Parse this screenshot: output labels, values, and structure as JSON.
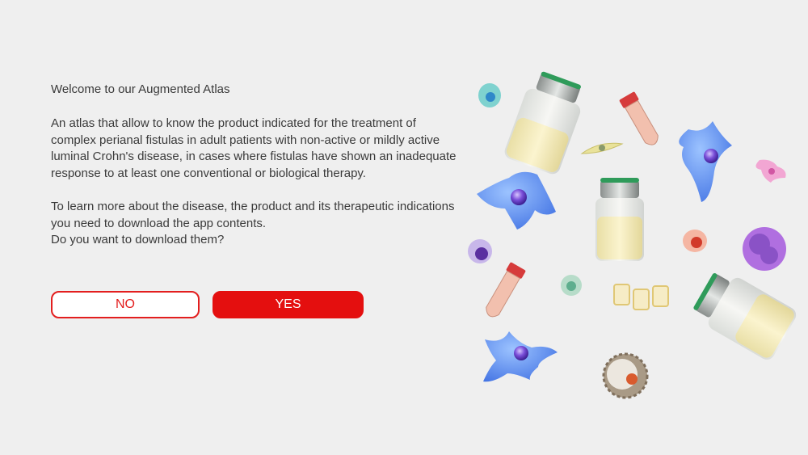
{
  "intro": {
    "welcome": "Welcome to our Augmented Atlas",
    "description": "An atlas that allow to know the product indicated for the treatment of complex perianal fistulas in adult patients with non-active or mildly active luminal Crohn's disease, in cases where fistulas have shown an inadequate response to at least one conventional or biological therapy.",
    "download_info": "To learn more about the disease, the product and its therapeutic indications you need to download the app contents.",
    "question": "Do you want to download them?"
  },
  "buttons": {
    "no_label": "NO",
    "yes_label": "YES"
  },
  "colors": {
    "background": "#efefef",
    "accent": "#e40f0f",
    "text": "#3a3a3a"
  },
  "illustration": {
    "items": [
      "vial-icon",
      "test-tube-icon",
      "dendritic-cell-icon",
      "round-cell-icon",
      "epithelial-cells-icon",
      "granular-cell-icon"
    ]
  }
}
